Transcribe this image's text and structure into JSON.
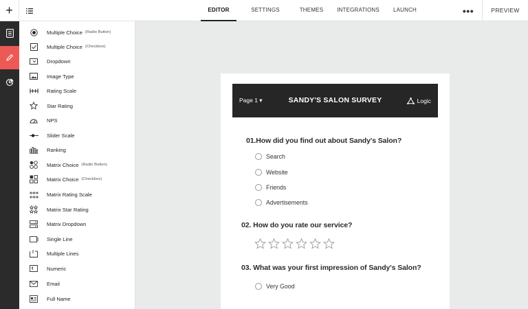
{
  "topbar": {
    "add_label": "+",
    "tabs": [
      {
        "label": "EDITOR",
        "active": true
      },
      {
        "label": "SETTINGS",
        "active": false
      },
      {
        "label": "THEMES",
        "active": false
      },
      {
        "label": "INTEGRATIONS",
        "active": false
      },
      {
        "label": "LAUNCH",
        "active": false
      }
    ],
    "more_label": "•••",
    "preview_label": "PREVIEW"
  },
  "rail": {
    "items": [
      {
        "icon": "document-icon",
        "active": false
      },
      {
        "icon": "pencil-icon",
        "active": true
      },
      {
        "icon": "pie-chart-icon",
        "active": false
      }
    ],
    "accent": "#ed5a56"
  },
  "question_types": [
    {
      "label": "Multiple Choice",
      "sub": "(Radio Button)",
      "icon": "radio-button-icon"
    },
    {
      "label": "Multiple Choice",
      "sub": "(Checkbox)",
      "icon": "checkbox-icon"
    },
    {
      "label": "Dropdown",
      "sub": "",
      "icon": "dropdown-icon"
    },
    {
      "label": "Image Type",
      "sub": "",
      "icon": "image-icon"
    },
    {
      "label": "Rating Scale",
      "sub": "",
      "icon": "rating-scale-icon"
    },
    {
      "label": "Star Rating",
      "sub": "",
      "icon": "star-icon"
    },
    {
      "label": "NPS",
      "sub": "",
      "icon": "gauge-icon"
    },
    {
      "label": "Slider Scale",
      "sub": "",
      "icon": "slider-icon"
    },
    {
      "label": "Ranking",
      "sub": "",
      "icon": "ranking-icon"
    },
    {
      "label": "Matrix Choice",
      "sub": "(Radio Button)",
      "icon": "matrix-radio-icon"
    },
    {
      "label": "Matrix Choice",
      "sub": "(Checkbox)",
      "icon": "matrix-checkbox-icon"
    },
    {
      "label": "Matrix Rating Scale",
      "sub": "",
      "icon": "matrix-rating-scale-icon"
    },
    {
      "label": "Matrix Star Rating",
      "sub": "",
      "icon": "matrix-star-icon"
    },
    {
      "label": "Matrix Dropdown",
      "sub": "",
      "icon": "matrix-dropdown-icon"
    },
    {
      "label": "Single Line",
      "sub": "",
      "icon": "single-line-icon"
    },
    {
      "label": "Multiple Lines",
      "sub": "",
      "icon": "multiple-lines-icon"
    },
    {
      "label": "Numeric",
      "sub": "",
      "icon": "numeric-icon"
    },
    {
      "label": "Email",
      "sub": "",
      "icon": "email-icon"
    },
    {
      "label": "Full Name",
      "sub": "",
      "icon": "full-name-icon"
    }
  ],
  "survey": {
    "page_label": "Page 1 ▾",
    "title": "SANDY'S SALON SURVEY",
    "logic_label": "Logic",
    "questions": [
      {
        "text": "01.How did you find out about Sandy's Salon?",
        "type": "radio",
        "options": [
          "Search",
          "Website",
          "Friends",
          "Advertisements"
        ]
      },
      {
        "text": "02. How do you rate our service?",
        "type": "stars",
        "star_count": 6
      },
      {
        "text": "03. What was your first impression of Sandy's Salon?",
        "type": "radio",
        "options": [
          "Very Good"
        ]
      }
    ]
  }
}
